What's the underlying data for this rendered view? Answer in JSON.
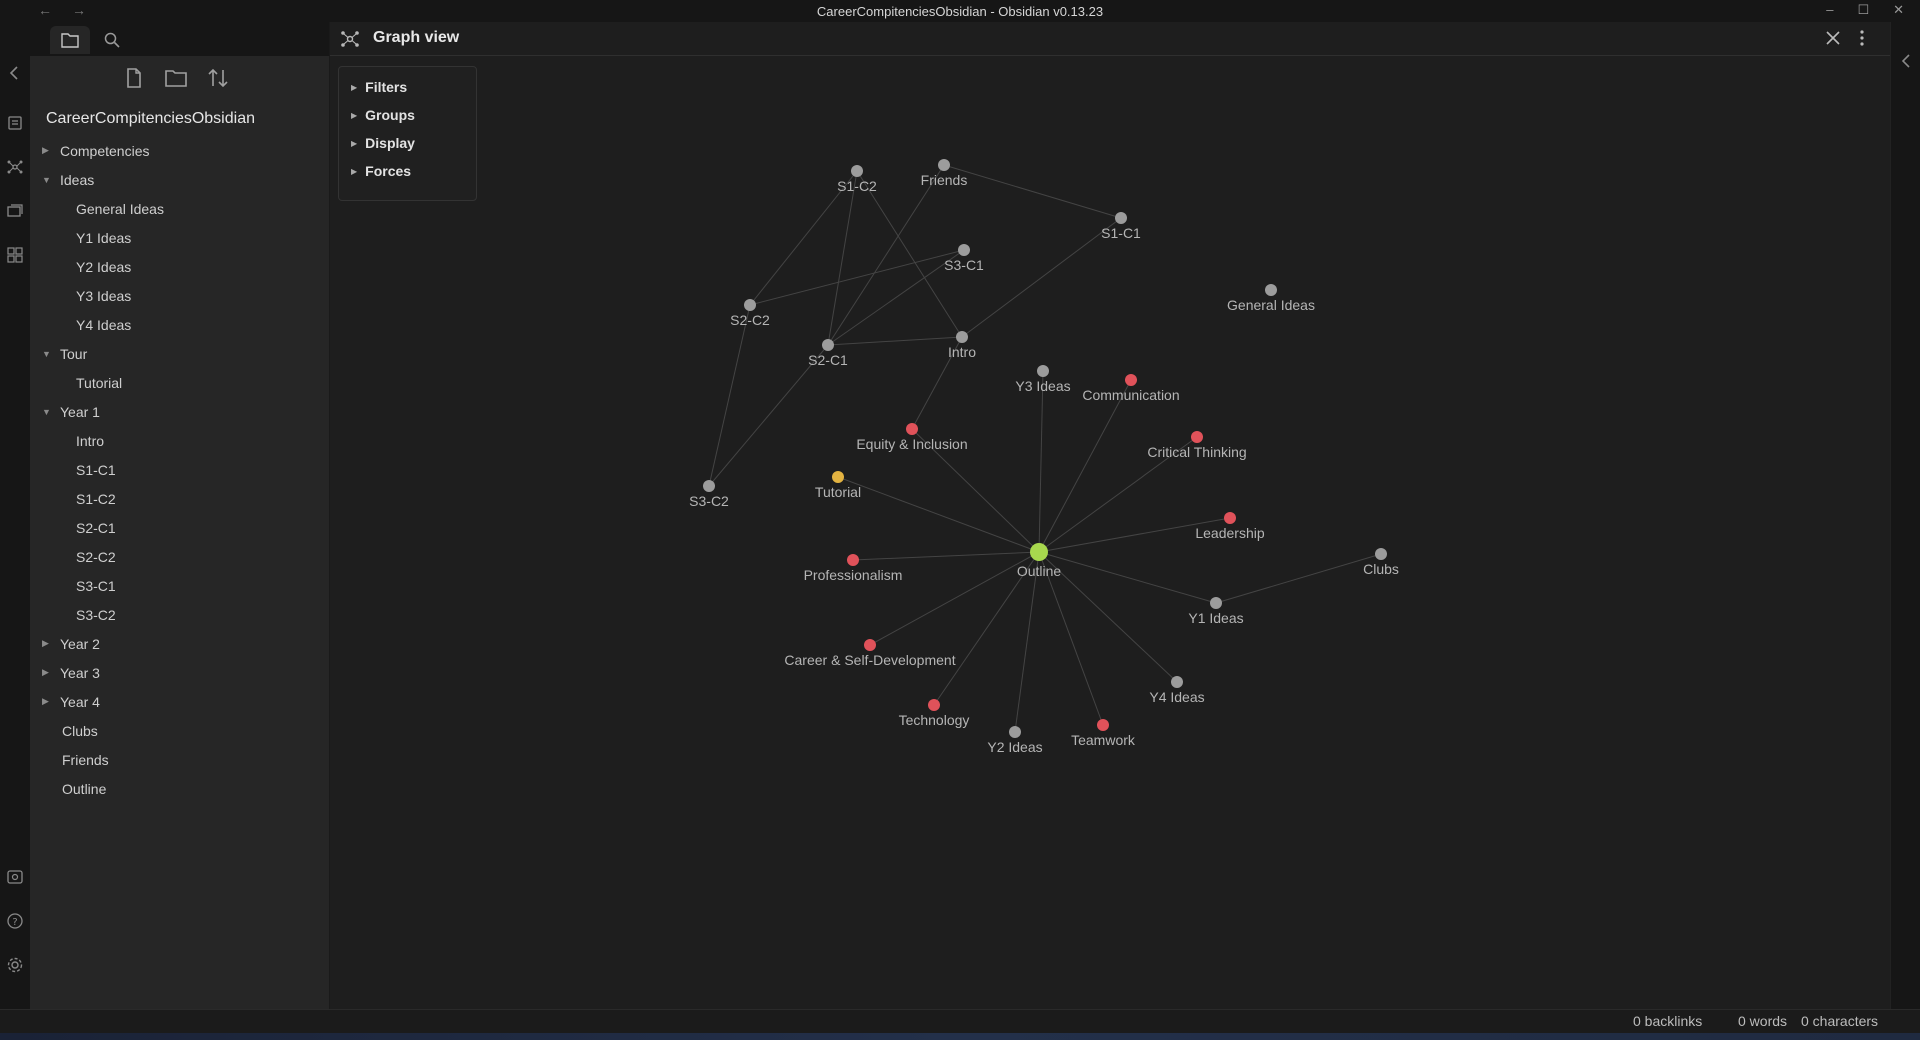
{
  "window": {
    "title": "CareerCompitenciesObsidian - Obsidian v0.13.23",
    "nav_back": "←",
    "nav_forward": "→",
    "minimize": "–",
    "maximize": "☐",
    "close": "✕"
  },
  "sidebar": {
    "vault_name": "CareerCompitenciesObsidian",
    "tree": [
      {
        "label": "Competencies",
        "type": "folder",
        "expanded": false
      },
      {
        "label": "Ideas",
        "type": "folder",
        "expanded": true
      },
      {
        "label": "General Ideas",
        "type": "file",
        "depth": 1
      },
      {
        "label": "Y1 Ideas",
        "type": "file",
        "depth": 1
      },
      {
        "label": "Y2 Ideas",
        "type": "file",
        "depth": 1
      },
      {
        "label": "Y3 Ideas",
        "type": "file",
        "depth": 1
      },
      {
        "label": "Y4 Ideas",
        "type": "file",
        "depth": 1
      },
      {
        "label": "Tour",
        "type": "folder",
        "expanded": true
      },
      {
        "label": "Tutorial",
        "type": "file",
        "depth": 1
      },
      {
        "label": "Year 1",
        "type": "folder",
        "expanded": true
      },
      {
        "label": "Intro",
        "type": "file",
        "depth": 1
      },
      {
        "label": "S1-C1",
        "type": "file",
        "depth": 1
      },
      {
        "label": "S1-C2",
        "type": "file",
        "depth": 1
      },
      {
        "label": "S2-C1",
        "type": "file",
        "depth": 1
      },
      {
        "label": "S2-C2",
        "type": "file",
        "depth": 1
      },
      {
        "label": "S3-C1",
        "type": "file",
        "depth": 1
      },
      {
        "label": "S3-C2",
        "type": "file",
        "depth": 1
      },
      {
        "label": "Year 2",
        "type": "folder",
        "expanded": false
      },
      {
        "label": "Year 3",
        "type": "folder",
        "expanded": false
      },
      {
        "label": "Year 4",
        "type": "folder",
        "expanded": false
      },
      {
        "label": "Clubs",
        "type": "file",
        "depth": 0
      },
      {
        "label": "Friends",
        "type": "file",
        "depth": 0
      },
      {
        "label": "Outline",
        "type": "file",
        "depth": 0
      }
    ]
  },
  "view": {
    "title": "Graph view",
    "controls": [
      "Filters",
      "Groups",
      "Display",
      "Forces"
    ]
  },
  "graph": {
    "colors": {
      "default": "#9c9c9c",
      "tag": "#e0525a",
      "attachment": "#e3b341",
      "active": "#a8d84e",
      "edge": "#444444"
    },
    "nodes": [
      {
        "id": "s1c2",
        "label": "S1-C2",
        "color": "default"
      },
      {
        "id": "friends",
        "label": "Friends",
        "color": "default"
      },
      {
        "id": "s1c1",
        "label": "S1-C1",
        "color": "default"
      },
      {
        "id": "s3c1",
        "label": "S3-C1",
        "color": "default"
      },
      {
        "id": "s2c2",
        "label": "S2-C2",
        "color": "default"
      },
      {
        "id": "general",
        "label": "General Ideas",
        "color": "default"
      },
      {
        "id": "s2c1",
        "label": "S2-C1",
        "color": "default"
      },
      {
        "id": "intro",
        "label": "Intro",
        "color": "default"
      },
      {
        "id": "y3",
        "label": "Y3 Ideas",
        "color": "default"
      },
      {
        "id": "comm",
        "label": "Communication",
        "color": "tag"
      },
      {
        "id": "equity",
        "label": "Equity & Inclusion",
        "color": "tag"
      },
      {
        "id": "critical",
        "label": "Critical Thinking",
        "color": "tag"
      },
      {
        "id": "tutorial",
        "label": "Tutorial",
        "color": "attachment"
      },
      {
        "id": "s3c2",
        "label": "S3-C2",
        "color": "default"
      },
      {
        "id": "leadership",
        "label": "Leadership",
        "color": "tag"
      },
      {
        "id": "outline",
        "label": "Outline",
        "color": "active"
      },
      {
        "id": "clubs",
        "label": "Clubs",
        "color": "default"
      },
      {
        "id": "prof",
        "label": "Professionalism",
        "color": "tag"
      },
      {
        "id": "y1",
        "label": "Y1 Ideas",
        "color": "default"
      },
      {
        "id": "career",
        "label": "Career & Self-Development",
        "color": "tag"
      },
      {
        "id": "y4",
        "label": "Y4 Ideas",
        "color": "default"
      },
      {
        "id": "tech",
        "label": "Technology",
        "color": "tag"
      },
      {
        "id": "teamwork",
        "label": "Teamwork",
        "color": "tag"
      },
      {
        "id": "y2",
        "label": "Y2 Ideas",
        "color": "default"
      }
    ],
    "edges": [
      [
        "friends",
        "s1c1"
      ],
      [
        "s1c2",
        "s2c2"
      ],
      [
        "s1c2",
        "s2c1"
      ],
      [
        "s1c2",
        "intro"
      ],
      [
        "friends",
        "s2c1"
      ],
      [
        "s2c2",
        "s3c1"
      ],
      [
        "s2c1",
        "s3c1"
      ],
      [
        "s2c1",
        "intro"
      ],
      [
        "intro",
        "s1c1"
      ],
      [
        "s2c2",
        "s3c2"
      ],
      [
        "s2c1",
        "s3c2"
      ],
      [
        "intro",
        "equity"
      ],
      [
        "outline",
        "y3"
      ],
      [
        "outline",
        "comm"
      ],
      [
        "outline",
        "critical"
      ],
      [
        "outline",
        "leadership"
      ],
      [
        "outline",
        "equity"
      ],
      [
        "outline",
        "tutorial"
      ],
      [
        "outline",
        "prof"
      ],
      [
        "outline",
        "y1"
      ],
      [
        "y1",
        "clubs"
      ],
      [
        "outline",
        "career"
      ],
      [
        "outline",
        "y4"
      ],
      [
        "outline",
        "tech"
      ],
      [
        "outline",
        "teamwork"
      ],
      [
        "outline",
        "y2"
      ]
    ]
  },
  "status": {
    "backlinks": "0 backlinks",
    "words": "0 words",
    "characters": "0 characters"
  }
}
